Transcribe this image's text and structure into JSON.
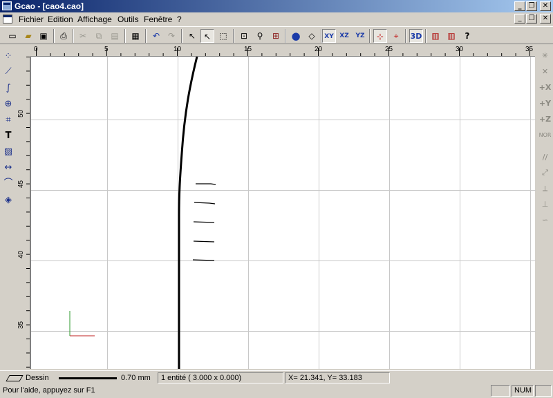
{
  "window": {
    "title": "Gcao - [cao4.cao]",
    "minimize_glyph": "_",
    "restore_glyph": "❐",
    "close_glyph": "✕"
  },
  "menu": {
    "items": [
      "Fichier",
      "Edition",
      "Affichage",
      "Outils",
      "Fenêtre",
      "?"
    ]
  },
  "toolbar": {
    "buttons": [
      {
        "name": "new-document-icon",
        "glyph": "▭"
      },
      {
        "name": "open-folder-icon",
        "glyph": "▰"
      },
      {
        "name": "save-disk-icon",
        "glyph": "▣"
      },
      {
        "name": "print-icon",
        "glyph": "⎙"
      },
      {
        "name": "cut-icon",
        "glyph": "✂"
      },
      {
        "name": "copy-icon",
        "glyph": "⧉"
      },
      {
        "name": "paste-icon",
        "glyph": "▤"
      },
      {
        "name": "properties-icon",
        "glyph": "▦"
      },
      {
        "name": "undo-icon",
        "glyph": "↶"
      },
      {
        "name": "redo-icon",
        "glyph": "↷"
      },
      {
        "name": "select-arrow-icon",
        "glyph": "↖"
      },
      {
        "name": "point-select-icon",
        "glyph": "↖"
      },
      {
        "name": "window-select-icon",
        "glyph": "⬚"
      },
      {
        "name": "zoom-window-icon",
        "glyph": "⊡"
      },
      {
        "name": "zoom-dynamic-icon",
        "glyph": "⚲"
      },
      {
        "name": "zoom-all-icon",
        "glyph": "⊞"
      },
      {
        "name": "render-sphere-icon",
        "glyph": "●"
      },
      {
        "name": "cube-view-icon",
        "glyph": "◇"
      },
      {
        "name": "plane-xy-icon",
        "glyph": "XY"
      },
      {
        "name": "plane-xz-icon",
        "glyph": "XZ"
      },
      {
        "name": "plane-yz-icon",
        "glyph": "YZ"
      },
      {
        "name": "snap-grid-icon",
        "glyph": "⊹"
      },
      {
        "name": "snap-object-icon",
        "glyph": "⌖"
      },
      {
        "name": "view-3d-icon",
        "glyph": "3D"
      },
      {
        "name": "projection-icon",
        "glyph": "▥"
      },
      {
        "name": "projection-3d-icon",
        "glyph": "▥"
      },
      {
        "name": "help-pointer-icon",
        "glyph": "?"
      }
    ]
  },
  "left_tools": [
    {
      "name": "point-tool-icon",
      "glyph": "⁘"
    },
    {
      "name": "polyline-tool-icon",
      "glyph": "⟋"
    },
    {
      "name": "curve-tool-icon",
      "glyph": "∫"
    },
    {
      "name": "circle-tool-icon",
      "glyph": "⊕"
    },
    {
      "name": "trim-tool-icon",
      "glyph": "⌗"
    },
    {
      "name": "text-tool-icon",
      "glyph": "T"
    },
    {
      "name": "hatch-tool-icon",
      "glyph": "▨"
    },
    {
      "name": "dimension-tool-icon",
      "glyph": "↔"
    },
    {
      "name": "fillet-tool-icon",
      "glyph": "⌒"
    },
    {
      "name": "eraser-tool-icon",
      "glyph": "◈"
    }
  ],
  "right_tools": [
    {
      "name": "snap-point-icon",
      "glyph": "✳"
    },
    {
      "name": "snap-intersection-icon",
      "glyph": "✕"
    },
    {
      "name": "axis-x-icon",
      "glyph": "+X"
    },
    {
      "name": "axis-y-icon",
      "glyph": "+Y"
    },
    {
      "name": "axis-z-icon",
      "glyph": "+Z"
    },
    {
      "name": "normal-icon",
      "glyph": "NOR"
    },
    {
      "name": "parallel-icon",
      "glyph": "//"
    },
    {
      "name": "tangent-icon",
      "glyph": "⤢"
    },
    {
      "name": "perpendicular-point-icon",
      "glyph": "⟂"
    },
    {
      "name": "perpendicular-icon",
      "glyph": "⊥"
    },
    {
      "name": "curve-snap-icon",
      "glyph": "∽"
    }
  ],
  "ruler": {
    "top_labels": [
      "0",
      "5",
      "10",
      "15",
      "20",
      "25",
      "30",
      "35"
    ],
    "left_labels": [
      "50",
      "45",
      "40",
      "35"
    ]
  },
  "edit_bar": {
    "layer": "Dessin",
    "line_width": "0.70 mm",
    "entity_info": "1 entité  (    3.000 x     0.000)",
    "coords": "X=    21.341, Y=     33.183"
  },
  "status_bar": {
    "help_text": "Pour l'aide, appuyez sur F1",
    "num": "NUM"
  }
}
